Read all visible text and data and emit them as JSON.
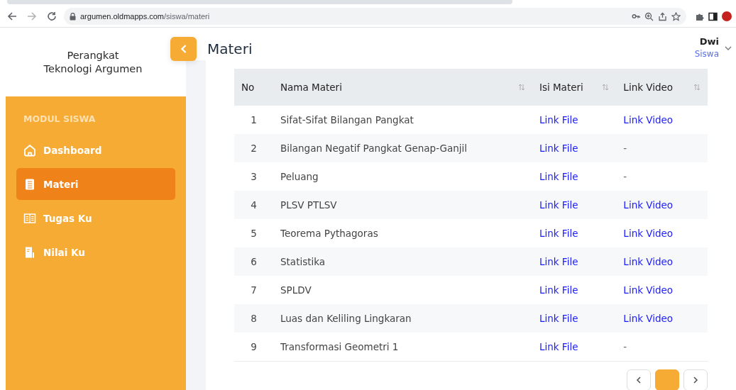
{
  "browser": {
    "url_host": "argumen.oldmapps.com",
    "url_path": "/siswa/materi"
  },
  "brand": {
    "line1": "Perangkat",
    "line2": "Teknologi Argumen"
  },
  "sidebar": {
    "section": "MODUL SISWA",
    "items": [
      {
        "label": "Dashboard",
        "kind": "home",
        "selected": false
      },
      {
        "label": "Materi",
        "kind": "book",
        "selected": true
      },
      {
        "label": "Tugas Ku",
        "kind": "columns",
        "selected": false
      },
      {
        "label": "Nilai Ku",
        "kind": "doc",
        "selected": false
      }
    ]
  },
  "page_title": "Materi",
  "user": {
    "name": "Dwi",
    "role": "Siswa"
  },
  "table": {
    "columns": [
      {
        "label": "No",
        "sortable": false
      },
      {
        "label": "Nama Materi",
        "sortable": true
      },
      {
        "label": "Isi Materi",
        "sortable": true
      },
      {
        "label": "Link Video",
        "sortable": true
      }
    ],
    "rows": [
      {
        "no": "1",
        "name": "Sifat-Sifat Bilangan Pangkat",
        "file": "Link File",
        "video": "Link Video"
      },
      {
        "no": "2",
        "name": "Bilangan Negatif Pangkat Genap-Ganjil",
        "file": "Link File",
        "video": "-"
      },
      {
        "no": "3",
        "name": "Peluang",
        "file": "Link File",
        "video": "-"
      },
      {
        "no": "4",
        "name": "PLSV PTLSV",
        "file": "Link File",
        "video": "Link Video"
      },
      {
        "no": "5",
        "name": "Teorema Pythagoras",
        "file": "Link File",
        "video": "Link Video"
      },
      {
        "no": "6",
        "name": "Statistika",
        "file": "Link File",
        "video": "Link Video"
      },
      {
        "no": "7",
        "name": "SPLDV",
        "file": "Link File",
        "video": "Link Video"
      },
      {
        "no": "8",
        "name": "Luas dan Keliling Lingkaran",
        "file": "Link File",
        "video": "Link Video"
      },
      {
        "no": "9",
        "name": "Transformasi Geometri 1",
        "file": "Link File",
        "video": "-"
      }
    ]
  },
  "pagination": [
    {
      "kind": "prev",
      "selected": false
    },
    {
      "kind": "page",
      "selected": true
    },
    {
      "kind": "next",
      "selected": false
    }
  ]
}
